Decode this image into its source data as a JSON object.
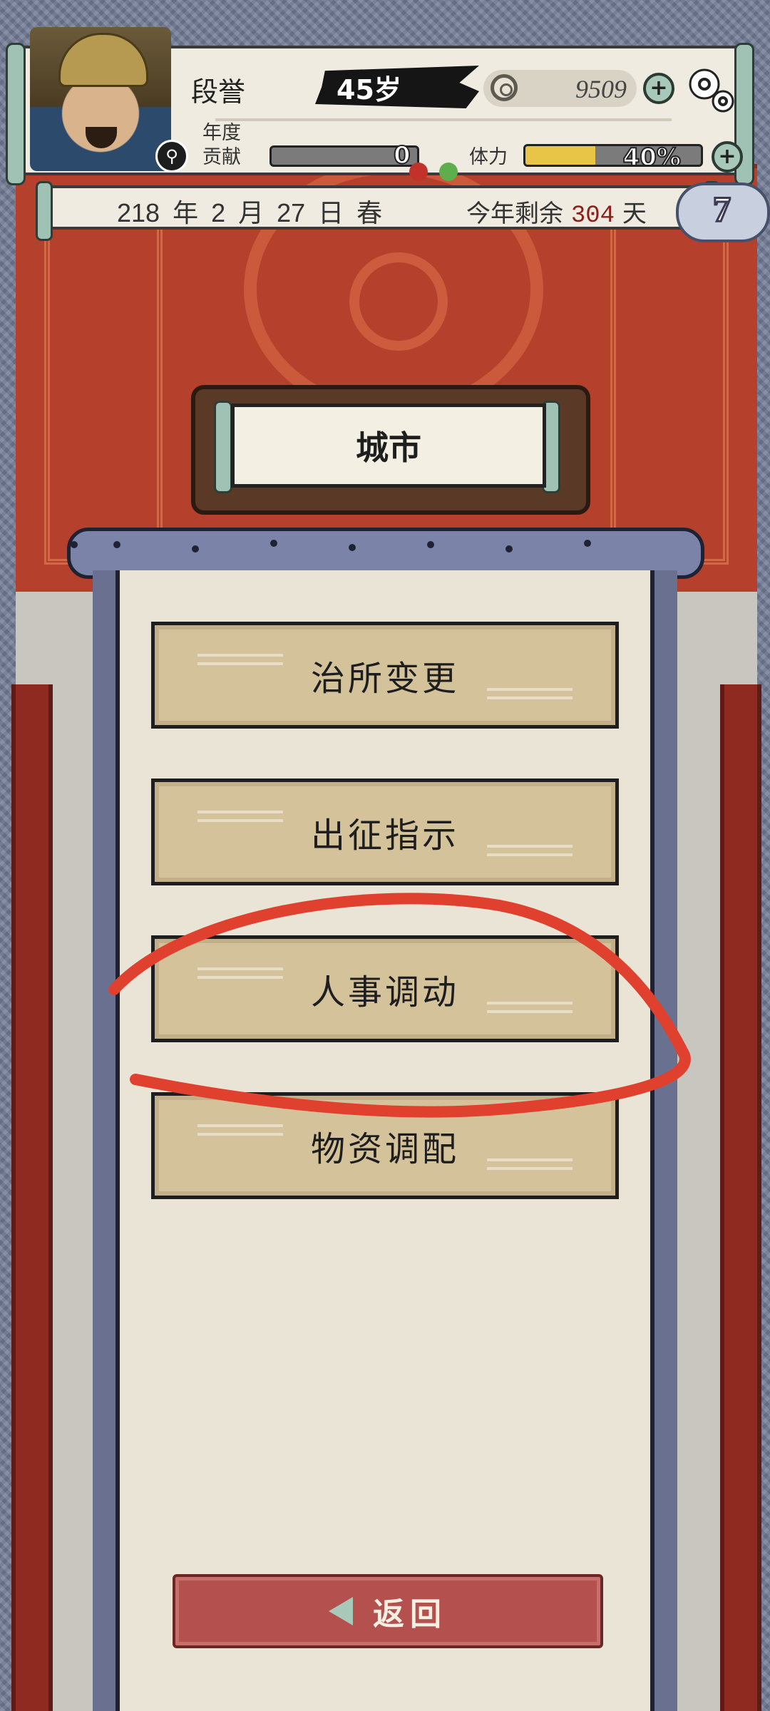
{
  "player": {
    "name": "段誉",
    "age": "45岁",
    "money": "9509",
    "year_label": "年度",
    "contribution_label": "贡献",
    "contribution_value": "0",
    "stamina_label": "体力",
    "stamina_value": "40%",
    "stamina_fraction": 0.4
  },
  "date": {
    "text": "218 年 2 月 27 日 春",
    "remaining_prefix": "今年剩余",
    "remaining_days": "304",
    "remaining_suffix": "天",
    "badge": "7"
  },
  "page": {
    "title": "城市"
  },
  "menu": {
    "items": [
      {
        "label": "治所变更"
      },
      {
        "label": "出征指示"
      },
      {
        "label": "人事调动"
      },
      {
        "label": "物资调配"
      }
    ]
  },
  "footer": {
    "back_label": "返回"
  },
  "colors": {
    "annotation": "#e0402e",
    "stamina_fill": "#e8c447",
    "button_bg": "#d4c29b",
    "back_bg": "#b4504e"
  },
  "icons": [
    "search-icon",
    "coin-icon",
    "plus-icon",
    "gear-icon",
    "hourglass-icon",
    "back-arrow-icon"
  ]
}
